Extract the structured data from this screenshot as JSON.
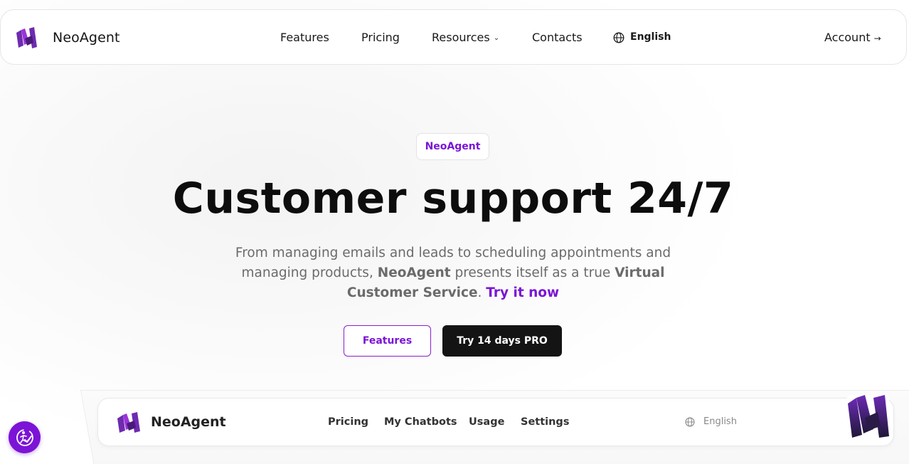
{
  "navbar": {
    "brand": "NeoAgent",
    "links": [
      "Features",
      "Pricing",
      "Resources",
      "Contacts"
    ],
    "language": "English",
    "account": "Account",
    "account_arrow": "→",
    "resources_chevron": "⌄"
  },
  "hero": {
    "badge": "NeoAgent",
    "title": "Customer support 24/7",
    "desc_part1": "From managing emails and leads to scheduling appointments and managing products, ",
    "desc_brand": "NeoAgent",
    "desc_part2": " presents itself as a true ",
    "desc_strong": "Virtual Customer Service",
    "desc_part3": ". ",
    "desc_cta": "Try it now",
    "button_features": "Features",
    "button_try": "Try 14 days PRO"
  },
  "preview": {
    "brand": "NeoAgent",
    "links": [
      "Pricing",
      "My Chatbots",
      "Usage",
      "Settings"
    ],
    "language": "English"
  },
  "colors": {
    "accent": "#7b14d6",
    "dark": "#141414",
    "muted_text": "#6b6b6b"
  },
  "icons": {
    "logo": "neoagent-logo-icon",
    "globe": "globe-icon",
    "chevron": "chevron-down-icon",
    "arrow": "arrow-right-icon",
    "accessibility": "accessibility-icon",
    "avatar": "neoagent-avatar-icon"
  }
}
